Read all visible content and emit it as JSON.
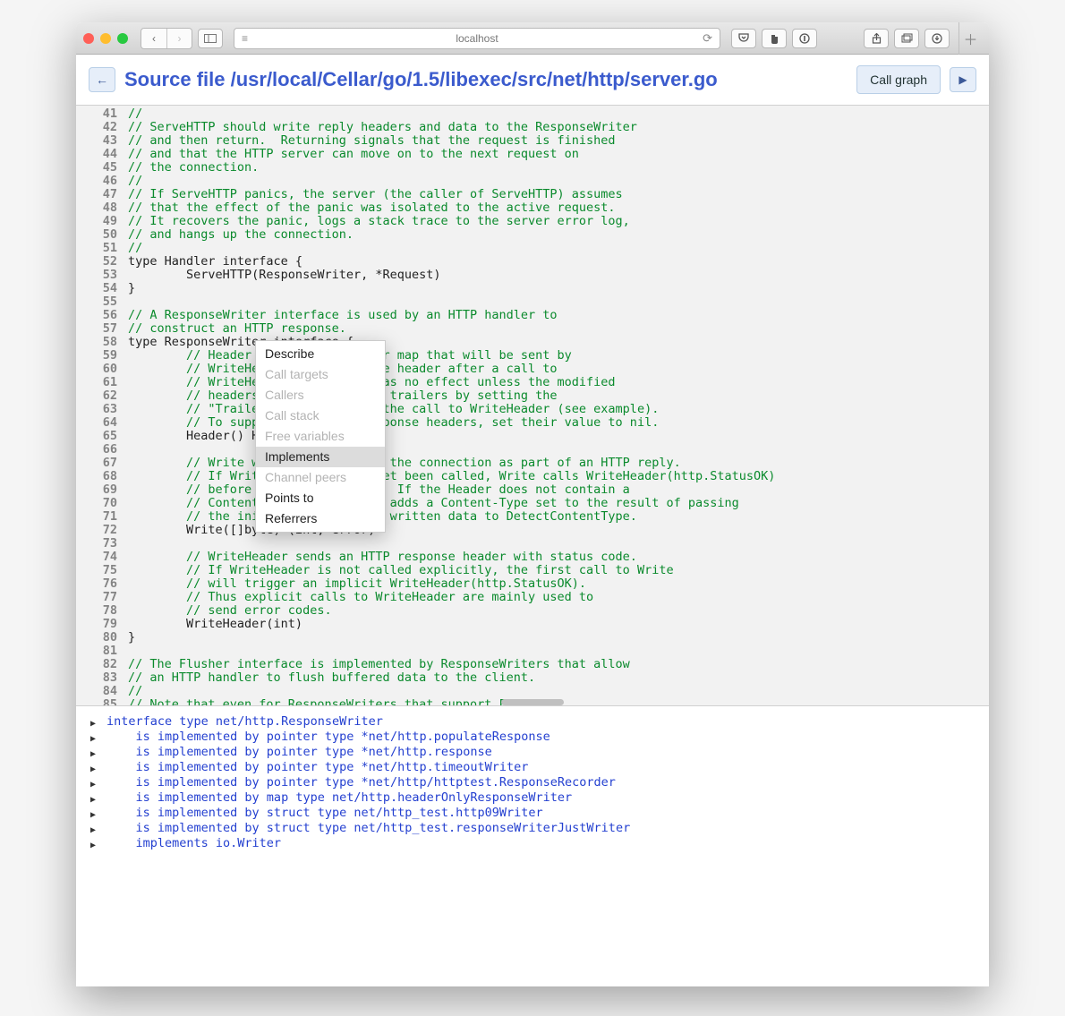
{
  "browser": {
    "address": "localhost"
  },
  "header": {
    "title": "Source file /usr/local/Cellar/go/1.5/libexec/src/net/http/server.go",
    "call_graph_label": "Call graph"
  },
  "code_lines": [
    {
      "n": "41",
      "cls": "comment",
      "t": "//"
    },
    {
      "n": "42",
      "cls": "comment",
      "t": "// ServeHTTP should write reply headers and data to the ResponseWriter"
    },
    {
      "n": "43",
      "cls": "comment",
      "t": "// and then return.  Returning signals that the request is finished"
    },
    {
      "n": "44",
      "cls": "comment",
      "t": "// and that the HTTP server can move on to the next request on"
    },
    {
      "n": "45",
      "cls": "comment",
      "t": "// the connection."
    },
    {
      "n": "46",
      "cls": "comment",
      "t": "//"
    },
    {
      "n": "47",
      "cls": "comment",
      "t": "// If ServeHTTP panics, the server (the caller of ServeHTTP) assumes"
    },
    {
      "n": "48",
      "cls": "comment",
      "t": "// that the effect of the panic was isolated to the active request."
    },
    {
      "n": "49",
      "cls": "comment",
      "t": "// It recovers the panic, logs a stack trace to the server error log,"
    },
    {
      "n": "50",
      "cls": "comment",
      "t": "// and hangs up the connection."
    },
    {
      "n": "51",
      "cls": "comment",
      "t": "//"
    },
    {
      "n": "52",
      "cls": "",
      "t": "type Handler interface {"
    },
    {
      "n": "53",
      "cls": "",
      "t": "        ServeHTTP(ResponseWriter, *Request)"
    },
    {
      "n": "54",
      "cls": "",
      "t": "}"
    },
    {
      "n": "55",
      "cls": "",
      "t": ""
    },
    {
      "n": "56",
      "cls": "comment",
      "t": "// A ResponseWriter interface is used by an HTTP handler to"
    },
    {
      "n": "57",
      "cls": "comment",
      "t": "// construct an HTTP response."
    },
    {
      "n": "58",
      "cls": "",
      "t": "type ResponseWriter interface {"
    },
    {
      "n": "59",
      "cls": "comment",
      "t": "        // Header returns the header map that will be sent by"
    },
    {
      "n": "60",
      "cls": "comment",
      "t": "        // WriteHeader. Changing the header after a call to"
    },
    {
      "n": "61",
      "cls": "comment",
      "t": "        // WriteHeader (or Write) has no effect unless the modified"
    },
    {
      "n": "62",
      "cls": "comment",
      "t": "        // headers were declared as trailers by setting the"
    },
    {
      "n": "63",
      "cls": "comment",
      "t": "        // \"Trailer\" header before the call to WriteHeader (see example)."
    },
    {
      "n": "64",
      "cls": "comment",
      "t": "        // To suppress implicit response headers, set their value to nil."
    },
    {
      "n": "65",
      "cls": "",
      "t": "        Header() Header"
    },
    {
      "n": "66",
      "cls": "",
      "t": ""
    },
    {
      "n": "67",
      "cls": "comment",
      "t": "        // Write writes the data to the connection as part of an HTTP reply."
    },
    {
      "n": "68",
      "cls": "comment",
      "t": "        // If WriteHeader has not yet been called, Write calls WriteHeader(http.StatusOK)"
    },
    {
      "n": "69",
      "cls": "comment",
      "t": "        // before writing the data.  If the Header does not contain a"
    },
    {
      "n": "70",
      "cls": "comment",
      "t": "        // Content-Type line, Write adds a Content-Type set to the result of passing"
    },
    {
      "n": "71",
      "cls": "comment",
      "t": "        // the initial 512 bytes of written data to DetectContentType."
    },
    {
      "n": "72",
      "cls": "",
      "t": "        Write([]byte) (int, error)"
    },
    {
      "n": "73",
      "cls": "",
      "t": ""
    },
    {
      "n": "74",
      "cls": "comment",
      "t": "        // WriteHeader sends an HTTP response header with status code."
    },
    {
      "n": "75",
      "cls": "comment",
      "t": "        // If WriteHeader is not called explicitly, the first call to Write"
    },
    {
      "n": "76",
      "cls": "comment",
      "t": "        // will trigger an implicit WriteHeader(http.StatusOK)."
    },
    {
      "n": "77",
      "cls": "comment",
      "t": "        // Thus explicit calls to WriteHeader are mainly used to"
    },
    {
      "n": "78",
      "cls": "comment",
      "t": "        // send error codes."
    },
    {
      "n": "79",
      "cls": "",
      "t": "        WriteHeader(int)"
    },
    {
      "n": "80",
      "cls": "",
      "t": "}"
    },
    {
      "n": "81",
      "cls": "",
      "t": ""
    },
    {
      "n": "82",
      "cls": "comment",
      "t": "// The Flusher interface is implemented by ResponseWriters that allow"
    },
    {
      "n": "83",
      "cls": "comment",
      "t": "// an HTTP handler to flush buffered data to the client."
    },
    {
      "n": "84",
      "cls": "comment",
      "t": "//"
    },
    {
      "n": "85",
      "cls": "comment",
      "t": "// Note that even for ResponseWriters that support Flush,"
    }
  ],
  "context_menu": {
    "items": [
      {
        "label": "Describe",
        "state": "enabled"
      },
      {
        "label": "Call targets",
        "state": "disabled"
      },
      {
        "label": "Callers",
        "state": "disabled"
      },
      {
        "label": "Call stack",
        "state": "disabled"
      },
      {
        "label": "Free variables",
        "state": "disabled"
      },
      {
        "label": "Implements",
        "state": "selected"
      },
      {
        "label": "Channel peers",
        "state": "disabled"
      },
      {
        "label": "Points to",
        "state": "enabled"
      },
      {
        "label": "Referrers",
        "state": "enabled"
      }
    ]
  },
  "output_lines": [
    {
      "indent": "",
      "t": "interface type net/http.ResponseWriter"
    },
    {
      "indent": "    ",
      "t": "is implemented by pointer type *net/http.populateResponse"
    },
    {
      "indent": "    ",
      "t": "is implemented by pointer type *net/http.response"
    },
    {
      "indent": "    ",
      "t": "is implemented by pointer type *net/http.timeoutWriter"
    },
    {
      "indent": "    ",
      "t": "is implemented by pointer type *net/http/httptest.ResponseRecorder"
    },
    {
      "indent": "    ",
      "t": "is implemented by map type net/http.headerOnlyResponseWriter"
    },
    {
      "indent": "    ",
      "t": "is implemented by struct type net/http_test.http09Writer"
    },
    {
      "indent": "    ",
      "t": "is implemented by struct type net/http_test.responseWriterJustWriter"
    },
    {
      "indent": "    ",
      "t": "implements io.Writer"
    }
  ]
}
